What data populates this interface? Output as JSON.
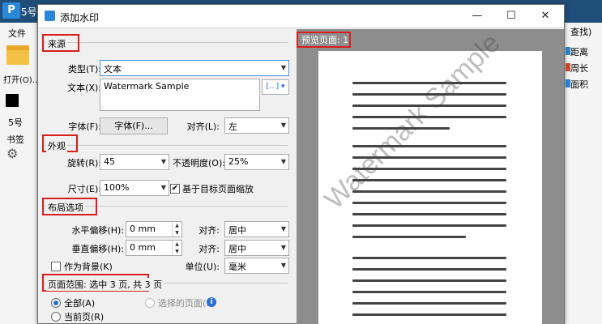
{
  "app": {
    "logo": "P",
    "title": "5号 ",
    "file_menu": "文件",
    "open": "打开(O)...",
    "font_size": "5号",
    "bookmark": "书签"
  },
  "right_toolbar": {
    "items": [
      "查找)",
      "距离",
      "周长",
      "面积"
    ]
  },
  "dialog": {
    "title": "添加水印",
    "minimize": "—",
    "maximize": "☐",
    "close": "✕"
  },
  "source": {
    "section_label": "来源",
    "type_label": "类型(T):",
    "type_value": "文本",
    "text_label": "文本(X):",
    "text_value": "Watermark Sample",
    "insert_icon": "[...]",
    "font_label": "字体(F):",
    "font_button": "字体(F)...",
    "align_label": "对齐(L):",
    "align_value": "左"
  },
  "appearance": {
    "section_label": "外观",
    "rotation_label": "旋转(R):",
    "rotation_value": "45",
    "opacity_label": "不透明度(O):",
    "opacity_value": "25%",
    "size_label": "尺寸(E):",
    "size_value": "100%",
    "relative_scale_label": "基于目标页面缩放",
    "relative_scale_checked": true
  },
  "layout": {
    "section_label": "布局选项",
    "h_offset_label": "水平偏移(H):",
    "h_offset_value": "0 mm",
    "h_align_label": "对齐:",
    "h_align_value": "居中",
    "v_offset_label": "垂直偏移(H):",
    "v_offset_value": "0 mm",
    "v_align_label": "对齐:",
    "v_align_value": "居中",
    "as_background_label": "作为背景(K)",
    "as_background_checked": false,
    "unit_label": "单位(U):",
    "unit_value": "毫米"
  },
  "page_range": {
    "section_label": "页面范围: 选中 3 页, 共 3 页",
    "all_label": "全部(A)",
    "selected_label": "选择的页面(S)",
    "current_label": "当前页(R)"
  },
  "preview": {
    "label": "预览页面: 1",
    "watermark": "Watermark Sample"
  },
  "colors": {
    "highlight": "#d81e1e",
    "titlebar": "#1f4e79",
    "preview_bg": "#8d8d8d"
  }
}
